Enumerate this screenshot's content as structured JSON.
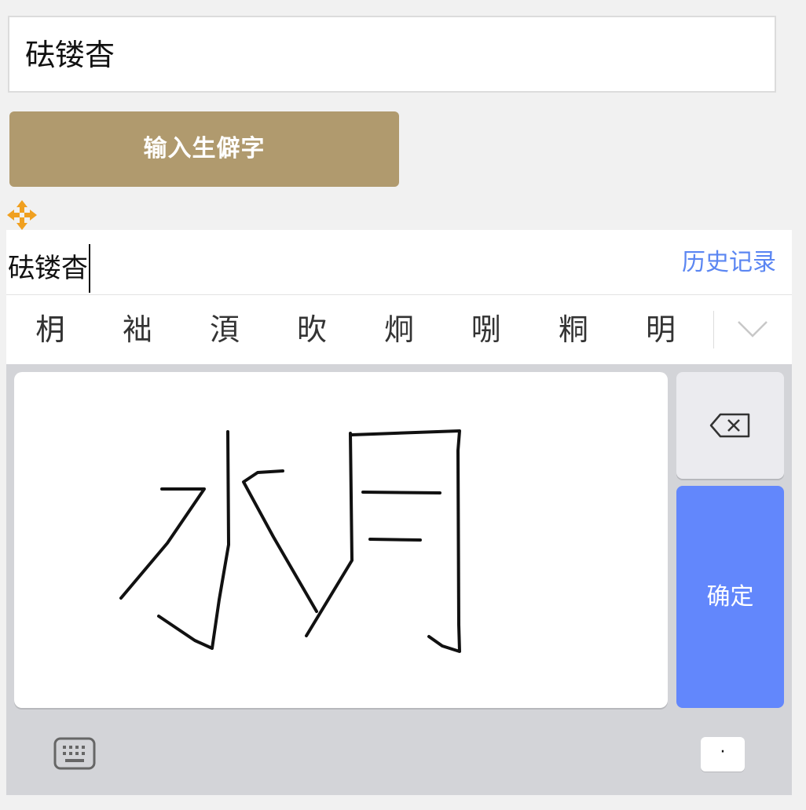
{
  "top_field": {
    "value": "砝镂杳"
  },
  "rare_button": {
    "label": "输入生僻字"
  },
  "ime": {
    "composition": "砝镂杳",
    "history_label": "历史记录",
    "candidates": [
      "枂",
      "袦",
      "湏",
      "欥",
      "炯",
      "哵",
      "粡",
      "明"
    ],
    "confirm_label": "确定",
    "period_label": "·"
  },
  "icons": {
    "move": "move-arrows-icon",
    "backspace": "backspace-icon",
    "expand": "chevron-down-icon",
    "keyboard": "keyboard-icon"
  },
  "colors": {
    "button_gold": "#b09a6e",
    "accent_blue": "#6287fc",
    "link_blue": "#5b86f2",
    "move_orange": "#f0a020"
  }
}
